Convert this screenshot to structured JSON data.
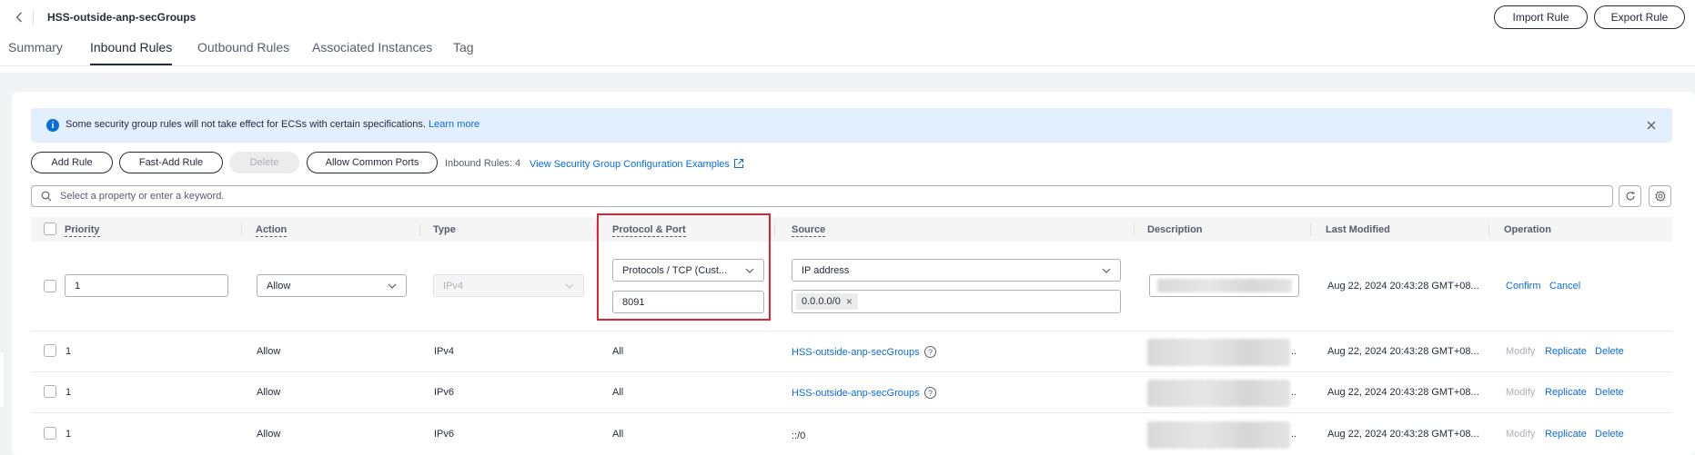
{
  "header": {
    "title": "HSS-outside-anp-secGroups",
    "import_label": "Import Rule",
    "export_label": "Export Rule"
  },
  "tabs": [
    "Summary",
    "Inbound Rules",
    "Outbound Rules",
    "Associated Instances",
    "Tag"
  ],
  "active_tab": "Inbound Rules",
  "alert": {
    "text": "Some security group rules will not take effect for ECSs with certain specifications.",
    "link": "Learn more"
  },
  "toolbar": {
    "add_rule": "Add Rule",
    "fast_add_rule": "Fast-Add Rule",
    "delete": "Delete",
    "allow_common_ports": "Allow Common Ports",
    "count_text": "Inbound Rules: 4",
    "examples_link": "View Security Group Configuration Examples"
  },
  "search": {
    "placeholder": "Select a property or enter a keyword."
  },
  "columns": [
    "Priority",
    "Action",
    "Type",
    "Protocol & Port",
    "Source",
    "Description",
    "Last Modified",
    "Operation"
  ],
  "edit_row": {
    "priority": "1",
    "action": "Allow",
    "type": "IPv4",
    "protocol": "Protocols / TCP (Cust...",
    "port": "8091",
    "source_type": "IP address",
    "source_tag": "0.0.0.0/0",
    "last_modified": "Aug 22, 2024 20:43:28 GMT+08...",
    "confirm": "Confirm",
    "cancel": "Cancel"
  },
  "rows": [
    {
      "priority": "1",
      "action": "Allow",
      "type": "IPv4",
      "protocol_port": "All",
      "source": "HSS-outside-anp-secGroups",
      "last_modified": "Aug 22, 2024 20:43:28 GMT+08...",
      "modify": "Modify",
      "replicate": "Replicate",
      "delete": "Delete"
    },
    {
      "priority": "1",
      "action": "Allow",
      "type": "IPv6",
      "protocol_port": "All",
      "source": "HSS-outside-anp-secGroups",
      "last_modified": "Aug 22, 2024 20:43:28 GMT+08...",
      "modify": "Modify",
      "replicate": "Replicate",
      "delete": "Delete"
    },
    {
      "priority": "1",
      "action": "Allow",
      "type": "IPv6",
      "protocol_port": "All",
      "source": "::/0",
      "last_modified": "Aug 22, 2024 20:43:28 GMT+08...",
      "modify": "Modify",
      "replicate": "Replicate",
      "delete": "Delete"
    }
  ],
  "ellipsis": "..",
  "colors": {
    "accent": "#0b6cdc",
    "highlight_box": "#e0242f",
    "alert_bg": "#e3efff"
  }
}
